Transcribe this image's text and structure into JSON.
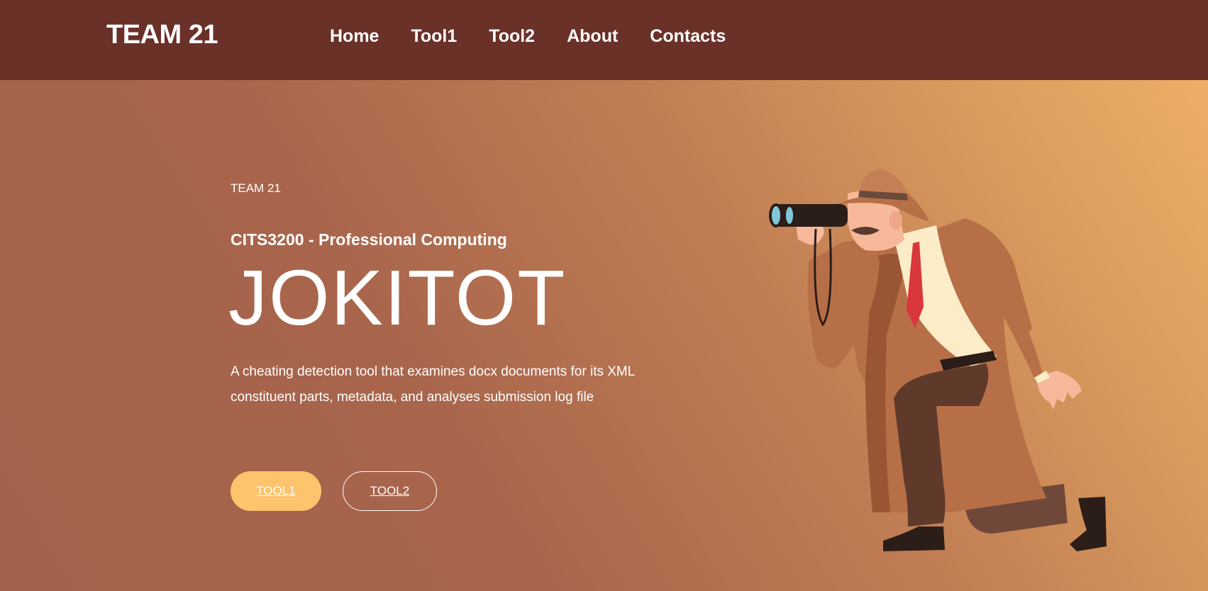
{
  "header": {
    "brand": "TEAM 21",
    "nav": [
      "Home",
      "Tool1",
      "Tool2",
      "About",
      "Contacts"
    ]
  },
  "hero": {
    "eyebrow": "TEAM 21",
    "subtitle": "CITS3200 - Professional Computing",
    "title": "JOKITOT",
    "description": "A cheating detection tool that examines docx documents for its XML constituent parts, metadata, and analyses submission log file",
    "buttons": {
      "primary": "TOOL1",
      "secondary": "TOOL2"
    },
    "illustration": "detective-with-binoculars"
  },
  "colors": {
    "navbar": "#6a3129",
    "hero_start": "#a4624c",
    "hero_end": "#eeae68",
    "button_primary": "#fec36d"
  }
}
